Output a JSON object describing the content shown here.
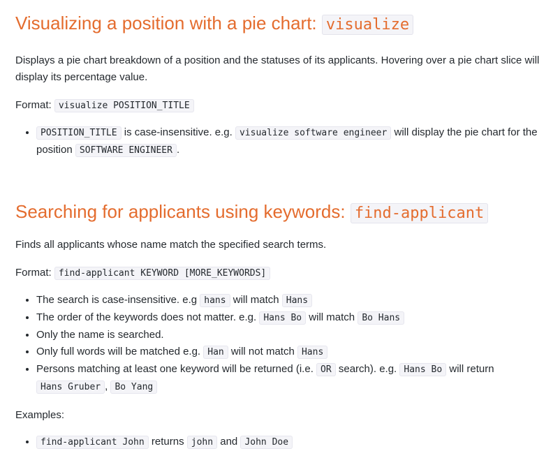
{
  "section1": {
    "title": "Visualizing a position with a pie chart: ",
    "title_code": "visualize",
    "description": "Displays a pie chart breakdown of a position and the statuses of its applicants. Hovering over a pie chart slice will display its percentage value.",
    "format_label": "Format: ",
    "format_code": "visualize POSITION_TITLE",
    "bullets": [
      {
        "code1": "POSITION_TITLE",
        "text1": " is case-insensitive. e.g. ",
        "code2": "visualize software engineer",
        "text2": " will display the pie chart for the position ",
        "code3": "SOFTWARE ENGINEER",
        "text3": "."
      }
    ]
  },
  "section2": {
    "title": "Searching for applicants using keywords: ",
    "title_code": "find-applicant",
    "description": "Finds all applicants whose name match the specified search terms.",
    "format_label": "Format: ",
    "format_code": "find-applicant KEYWORD [MORE_KEYWORDS]",
    "bullets": {
      "b1": {
        "text1": "The search is case-insensitive. e.g ",
        "code1": "hans",
        "text2": " will match ",
        "code2": "Hans"
      },
      "b2": {
        "text1": "The order of the keywords does not matter. e.g. ",
        "code1": "Hans Bo",
        "text2": " will match ",
        "code2": "Bo Hans"
      },
      "b3": {
        "text1": "Only the name is searched."
      },
      "b4": {
        "text1": "Only full words will be matched e.g. ",
        "code1": "Han",
        "text2": " will not match ",
        "code2": "Hans"
      },
      "b5": {
        "text1": "Persons matching at least one keyword will be returned (i.e. ",
        "code1": "OR",
        "text2": " search). e.g. ",
        "code2": "Hans Bo",
        "text3": " will return ",
        "code3": "Hans Gruber",
        "text4": ", ",
        "code4": "Bo Yang"
      }
    },
    "examples_label": "Examples:",
    "examples": [
      {
        "code1": "find-applicant John",
        "text1": " returns ",
        "code2": "john",
        "text2": " and ",
        "code3": "John Doe"
      }
    ]
  },
  "colors": {
    "heading": "#e46c2e",
    "text": "#24292e",
    "code_bg": "#f4f4f8"
  }
}
